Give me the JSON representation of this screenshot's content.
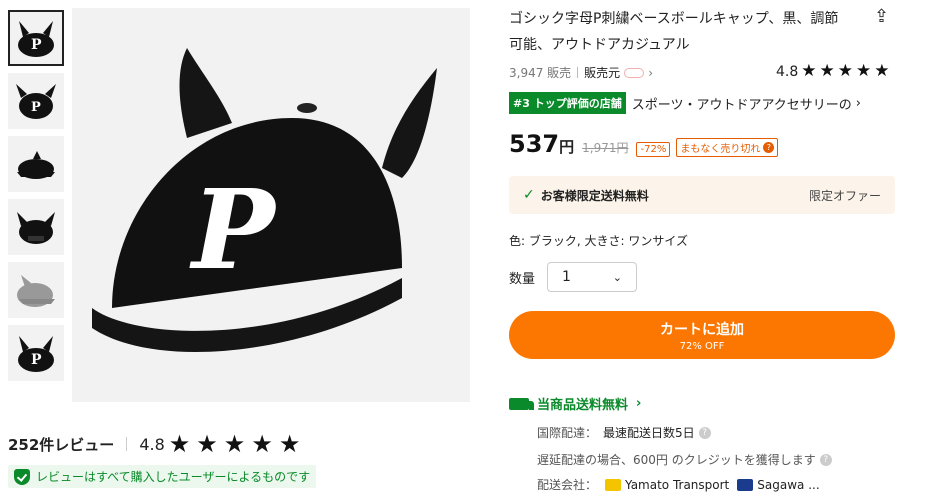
{
  "gallery": {
    "thumbnail_count": 6,
    "active_index": 0
  },
  "reviews": {
    "count_label": "252件レビュー",
    "score": "4.8",
    "verified_text": "レビューはすべて購入したユーザーによるものです"
  },
  "product": {
    "title": "ゴシック字母P刺繍ベースボールキャップ、黒、調節可能、アウトドアカジュアル",
    "sold": "3,947 販売",
    "seller_label": "販売元",
    "rating": "4.8",
    "rank_badge": "#3 トップ評価の店舗",
    "rank_category": "スポーツ・アウトドアアクセサリーの",
    "price": "537",
    "currency": "円",
    "original_price": "1,971円",
    "discount": "-72%",
    "soon_sold_out": "まもなく売り切れ",
    "offer_label": "お客様限定送料無料",
    "offer_tag": "限定オファー",
    "variant": "色: ブラック, 大きさ: ワンサイズ",
    "quantity_label": "数量",
    "quantity_value": "1",
    "cart_button": "カートに追加",
    "cart_sub": "72% OFF"
  },
  "shipping": {
    "heading": "当商品送料無料",
    "intl_label": "国際配達：",
    "intl_value": "最速配送日数5日",
    "delay_text": "遅延配達の場合、600円 のクレジットを獲得します",
    "carrier_label": "配送会社：",
    "carrier1": "Yamato Transport",
    "carrier2": "Sagawa ..."
  },
  "colors": {
    "accent": "#fb7701",
    "green": "#0a8a2a"
  }
}
